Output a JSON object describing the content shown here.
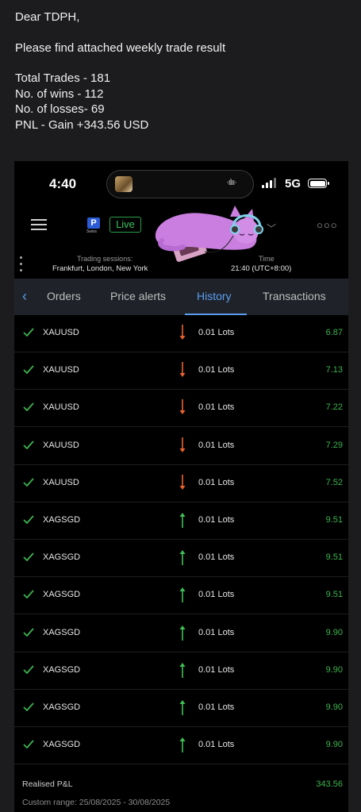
{
  "email": {
    "greeting": "Dear TDPH,",
    "intro": "Please find attached weekly trade result",
    "total_trades": "Total Trades - 181",
    "wins": "No. of wins - 112",
    "losses": "No. of losses- 69",
    "pnl": "PNL - Gain +343.56 USD"
  },
  "status_bar": {
    "time": "4:40",
    "network": "5G",
    "icons": [
      "album-art-icon",
      "waveform-icon",
      "signal-icon",
      "battery-icon"
    ]
  },
  "app_header": {
    "menu_icon": "hamburger-icon",
    "logo_letter": "P",
    "logo_text": "Swiss",
    "account_mode": "Live",
    "more_icon": "more-dots-icon",
    "trading_sessions_label": "Trading sessions:",
    "trading_sessions_value": "Frankfurt, London, New York",
    "time_label": "Time",
    "time_value": "21:40 (UTC+8:00)"
  },
  "tabs": [
    {
      "label": "Orders",
      "active": false
    },
    {
      "label": "Price alerts",
      "active": false
    },
    {
      "label": "History",
      "active": true
    },
    {
      "label": "Transactions",
      "active": false
    }
  ],
  "trades": [
    {
      "symbol": "XAUUSD",
      "direction": "sell",
      "lots": "0.01 Lots",
      "profit": "6.87"
    },
    {
      "symbol": "XAUUSD",
      "direction": "sell",
      "lots": "0.01 Lots",
      "profit": "7.13"
    },
    {
      "symbol": "XAUUSD",
      "direction": "sell",
      "lots": "0.01 Lots",
      "profit": "7.22"
    },
    {
      "symbol": "XAUUSD",
      "direction": "sell",
      "lots": "0.01 Lots",
      "profit": "7.29"
    },
    {
      "symbol": "XAUUSD",
      "direction": "sell",
      "lots": "0.01 Lots",
      "profit": "7.52"
    },
    {
      "symbol": "XAGSGD",
      "direction": "buy",
      "lots": "0.01 Lots",
      "profit": "9.51"
    },
    {
      "symbol": "XAGSGD",
      "direction": "buy",
      "lots": "0.01 Lots",
      "profit": "9.51"
    },
    {
      "symbol": "XAGSGD",
      "direction": "buy",
      "lots": "0.01 Lots",
      "profit": "9.51"
    },
    {
      "symbol": "XAGSGD",
      "direction": "buy",
      "lots": "0.01 Lots",
      "profit": "9.90"
    },
    {
      "symbol": "XAGSGD",
      "direction": "buy",
      "lots": "0.01 Lots",
      "profit": "9.90"
    },
    {
      "symbol": "XAGSGD",
      "direction": "buy",
      "lots": "0.01 Lots",
      "profit": "9.90"
    },
    {
      "symbol": "XAGSGD",
      "direction": "buy",
      "lots": "0.01 Lots",
      "profit": "9.90"
    }
  ],
  "footer": {
    "realised_label": "Realised P&L",
    "realised_value": "343.56",
    "custom_range": "Custom range: 25/08/2025 - 30/08/2025"
  },
  "colors": {
    "profit_green": "#3eb34f",
    "sell_arrow": "#e8632b",
    "buy_arrow": "#3fbf55",
    "accent_blue": "#5b9cf0",
    "check_green": "#3eb34f"
  }
}
